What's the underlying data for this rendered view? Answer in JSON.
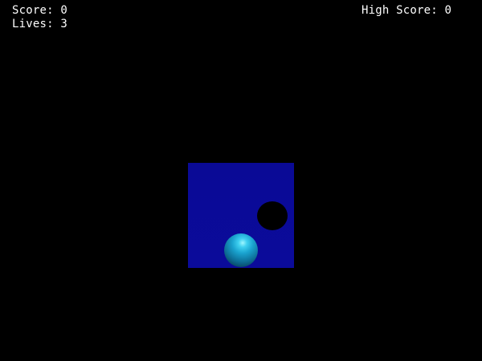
{
  "hud": {
    "score_text": "Score: 0",
    "lives_text": "Lives: 3",
    "high_score_text": "High Score: 0",
    "score": 0,
    "lives": 3,
    "high_score": 0
  },
  "colors": {
    "background": "#000000",
    "hud_text": "#ffffff",
    "board": "#0a0a96",
    "hole": "#000000",
    "ball": "#1aa3cf"
  }
}
